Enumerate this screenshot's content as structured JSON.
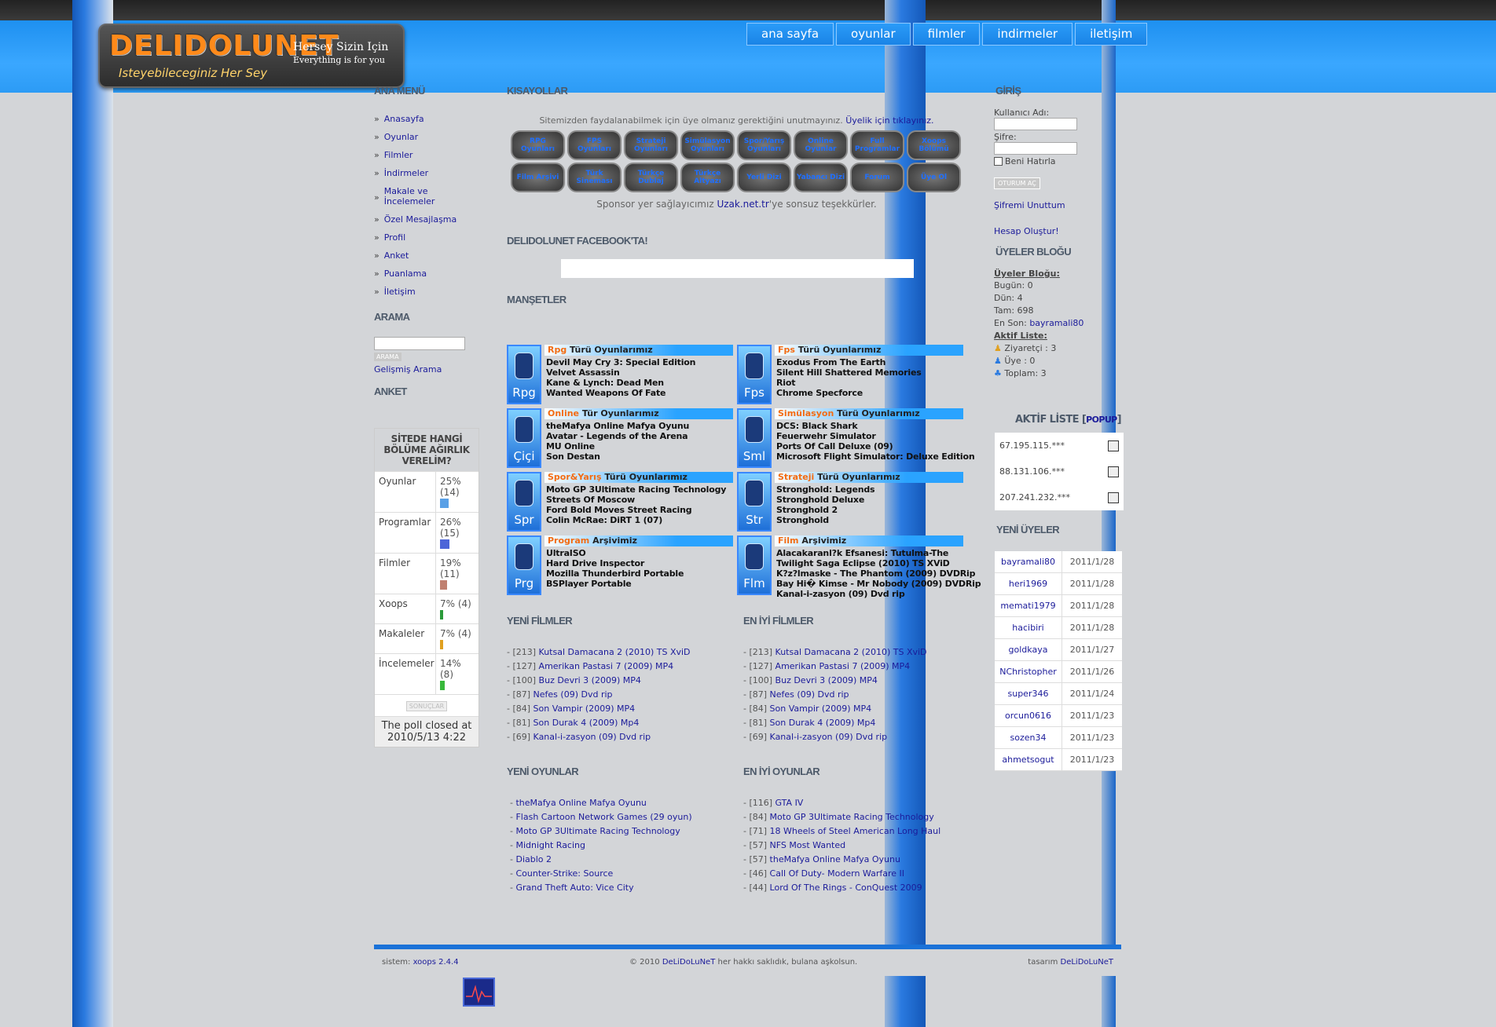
{
  "site": {
    "logo_main": "DELIDOLUNET",
    "logo_sub": "Isteyebileceginiz Her Sey",
    "tagline1": "Hersey Sizin Için",
    "tagline2": "Everything is for you"
  },
  "nav": [
    "ana sayfa",
    "oyunlar",
    "filmler",
    "indirmeler",
    "iletişim"
  ],
  "left": {
    "menu_title": "ANA MENÜ",
    "menu": [
      "Anasayfa",
      "Oyunlar",
      "Filmler",
      "İndirmeler",
      "Makale ve İncelemeler",
      "Özel Mesajlaşma",
      "Profil",
      "Anket",
      "Puanlama",
      "İletişim"
    ],
    "search_title": "ARAMA",
    "search_button": "ARAMA",
    "advanced_search": "Gelişmiş Arama",
    "poll_title": "ANKET",
    "poll_question": "SİTEDE HANGİ BÖLÜME AĞIRLIK VERELİM?",
    "poll_rows": [
      {
        "label": "Oyunlar",
        "result": "25% (14)",
        "pct": 25,
        "color": "#5aa0e6"
      },
      {
        "label": "Programlar",
        "result": "26% (15)",
        "pct": 26,
        "color": "#4c64d8"
      },
      {
        "label": "Filmler",
        "result": "19% (11)",
        "pct": 19,
        "color": "#c08070"
      },
      {
        "label": "Xoops",
        "result": "7% (4)",
        "pct": 7,
        "color": "#2a9a3a"
      },
      {
        "label": "Makaleler",
        "result": "7% (4)",
        "pct": 7,
        "color": "#e0a020"
      },
      {
        "label": "İncelemeler",
        "result": "14% (8)",
        "pct": 14,
        "color": "#38b83a"
      }
    ],
    "poll_results_button": "SONUÇLAR",
    "poll_closed": "The poll closed at 2010/5/13 4:22"
  },
  "center": {
    "shortcuts_title": "KISAYOLLAR",
    "notice": "Sitemizden faydalanabilmek için üye olmanız gerektiğini unutmayınız.",
    "notice_link": "Üyelik için tıklayınız.",
    "shortcuts": [
      "RPG Oyunları",
      "FPS Oyunları",
      "Strateji Oyunları",
      "Simülasyon Oyunları",
      "Spor/Yarış Oyunları",
      "Online Oyunlar",
      "Full Programlar",
      "Xoops Bölümü",
      "Film Arşivi",
      "Türk Sineması",
      "Türkçe Dublaj",
      "Türkçe Altyazı",
      "Yerli Dizi",
      "Yabancı Dizi",
      "Forum",
      "Üye Ol"
    ],
    "sponsor_pre": "Sponsor yer sağlayıcımız",
    "sponsor_link": "Uzak.net.tr",
    "sponsor_post": "'ye sonsuz teşekkürler.",
    "facebook_title": "DELIDOLUNET FACEBOOK'TA!",
    "headlines_title": "MANŞETLER",
    "boxes": [
      {
        "icon": "Rpg",
        "hdr_o": "Rpg",
        "hdr": " Türü Oyunlarımız",
        "items": [
          "Devil May Cry 3: Special Edition",
          "Velvet Assassin",
          "Kane & Lynch: Dead Men",
          "Wanted Weapons Of Fate"
        ]
      },
      {
        "icon": "Fps",
        "hdr_o": "Fps",
        "hdr": " Türü Oyunlarımız",
        "items": [
          "Exodus From The Earth",
          "Silent Hill Shattered Memories",
          "Riot",
          "Chrome Specforce"
        ]
      },
      {
        "icon": "Çiçi",
        "hdr_o": "Online",
        "hdr": " Tür Oyunlarımız",
        "items": [
          "theMafya Online Mafya Oyunu",
          "Avatar - Legends of the Arena",
          "MU Online",
          "Son Destan"
        ]
      },
      {
        "icon": "Sml",
        "hdr_o": "Simülasyon",
        "hdr": " Türü Oyunlarımız",
        "items": [
          "DCS: Black Shark",
          "Feuerwehr Simulator",
          "Ports Of Call Deluxe (09)",
          "Microsoft Flight Simulator: Deluxe Edition"
        ]
      },
      {
        "icon": "Spr",
        "hdr_o": "Spor&Yarış",
        "hdr": " Türü Oyunlarımız",
        "items": [
          "Moto GP 3Ultimate Racing Technology",
          "Streets Of Moscow",
          "Ford Bold Moves Street Racing",
          "Colin McRae: DiRT 1 (07)"
        ]
      },
      {
        "icon": "Str",
        "hdr_o": "Strateji",
        "hdr": " Türü Oyunlarımız",
        "items": [
          "Stronghold: Legends",
          "Stronghold Deluxe",
          "Stronghold 2",
          "Stronghold"
        ]
      },
      {
        "icon": "Prg",
        "hdr_o": "Program",
        "hdr": " Arşivimiz",
        "items": [
          "UltraISO",
          "Hard Drive Inspector",
          "Mozilla Thunderbird Portable",
          "BSPlayer Portable"
        ]
      },
      {
        "icon": "Flm",
        "hdr_o": "Film",
        "hdr": " Arşivimiz",
        "items": [
          "Alacakaranl?k Efsanesi: Tutulma-The Twilight Saga Eclipse (2010) TS XViD",
          "K?z?lmaske - The Phantom (2009) DVDRip",
          "Bay Hi� Kimse - Mr Nobody (2009) DVDRip",
          "Kanal-i-zasyon (09) Dvd rip"
        ]
      }
    ],
    "new_films_title": "YENİ FİLMLER",
    "best_films_title": "EN İYİ FİLMLER",
    "films": [
      {
        "n": "- [213] ",
        "t": "Kutsal Damacana 2 (2010) TS XviD"
      },
      {
        "n": "- [127] ",
        "t": "Amerikan Pastasi 7 (2009) MP4"
      },
      {
        "n": "- [100] ",
        "t": "Buz Devri 3 (2009) MP4"
      },
      {
        "n": "- [87] ",
        "t": "Nefes (09) Dvd rip"
      },
      {
        "n": "- [84] ",
        "t": "Son Vampir (2009) MP4"
      },
      {
        "n": "- [81] ",
        "t": "Son Durak 4 (2009) Mp4"
      },
      {
        "n": "- [69] ",
        "t": "Kanal-i-zasyon (09) Dvd rip"
      }
    ],
    "new_games_title": "YENİ OYUNLAR",
    "best_games_title": "EN İYİ OYUNLAR",
    "new_games": [
      "theMafya Online Mafya Oyunu",
      "Flash Cartoon Network Games (29 oyun)",
      "Moto GP 3Ultimate Racing Technology",
      "Midnight Racing",
      "Diablo 2",
      "Counter-Strike: Source",
      "Grand Theft Auto: Vice City"
    ],
    "best_games": [
      {
        "n": "- [116] ",
        "t": "GTA IV"
      },
      {
        "n": "- [84] ",
        "t": "Moto GP 3Ultimate Racing Technology"
      },
      {
        "n": "- [71] ",
        "t": "18 Wheels of Steel American Long Haul"
      },
      {
        "n": "- [57] ",
        "t": "NFS Most Wanted"
      },
      {
        "n": "- [57] ",
        "t": "theMafya Online Mafya Oyunu"
      },
      {
        "n": "- [46] ",
        "t": "Call Of Duty- Modern Warfare II"
      },
      {
        "n": "- [44] ",
        "t": "Lord Of The Rings - ConQuest 2009"
      }
    ]
  },
  "right": {
    "login_title": "GİRİŞ",
    "username_label": "Kullanıcı Adı:",
    "password_label": "Şifre:",
    "remember": "Beni Hatırla",
    "login_button": "OTURUM AÇ",
    "forgot": "Şifremi Unuttum",
    "register": "Hesap Oluştur!",
    "blog_title": "ÜYELER BLOĞU",
    "blog_sub": "Üyeler Bloğu:",
    "today": "Bugün: 0",
    "yesterday": "Dün: 4",
    "total": "Tam: 698",
    "last_pre": "En Son: ",
    "last_user": "bayramali80",
    "active_list": "Aktif Liste:",
    "visitors": "Ziyaretçi : 3",
    "members": "Üye : 0",
    "total_online": "Toplam: 3",
    "active_title": "AKTİF LİSTE",
    "popup": "POPUP",
    "ips": [
      "67.195.115.***",
      "88.131.106.***",
      "207.241.232.***"
    ],
    "new_users_title": "YENİ ÜYELER",
    "new_users": [
      {
        "u": "bayramali80",
        "d": "2011/1/28"
      },
      {
        "u": "heri1969",
        "d": "2011/1/28"
      },
      {
        "u": "memati1979",
        "d": "2011/1/28"
      },
      {
        "u": "hacibiri",
        "d": "2011/1/28"
      },
      {
        "u": "goldkaya",
        "d": "2011/1/27"
      },
      {
        "u": "NChristopher",
        "d": "2011/1/26"
      },
      {
        "u": "super346",
        "d": "2011/1/24"
      },
      {
        "u": "orcun0616",
        "d": "2011/1/23"
      },
      {
        "u": "sozen34",
        "d": "2011/1/23"
      },
      {
        "u": "ahmetsogut",
        "d": "2011/1/23"
      }
    ]
  },
  "footer": {
    "sys_pre": "sistem: ",
    "sys": "xoops 2.4.4",
    "copy_pre": "© 2010 ",
    "copy_brand": "DeLiDoLuNeT",
    "copy_post": " her hakkı saklıdık, bulana aşkolsun.",
    "design_pre": "tasarım ",
    "design": "DeLiDoLuNeT"
  }
}
